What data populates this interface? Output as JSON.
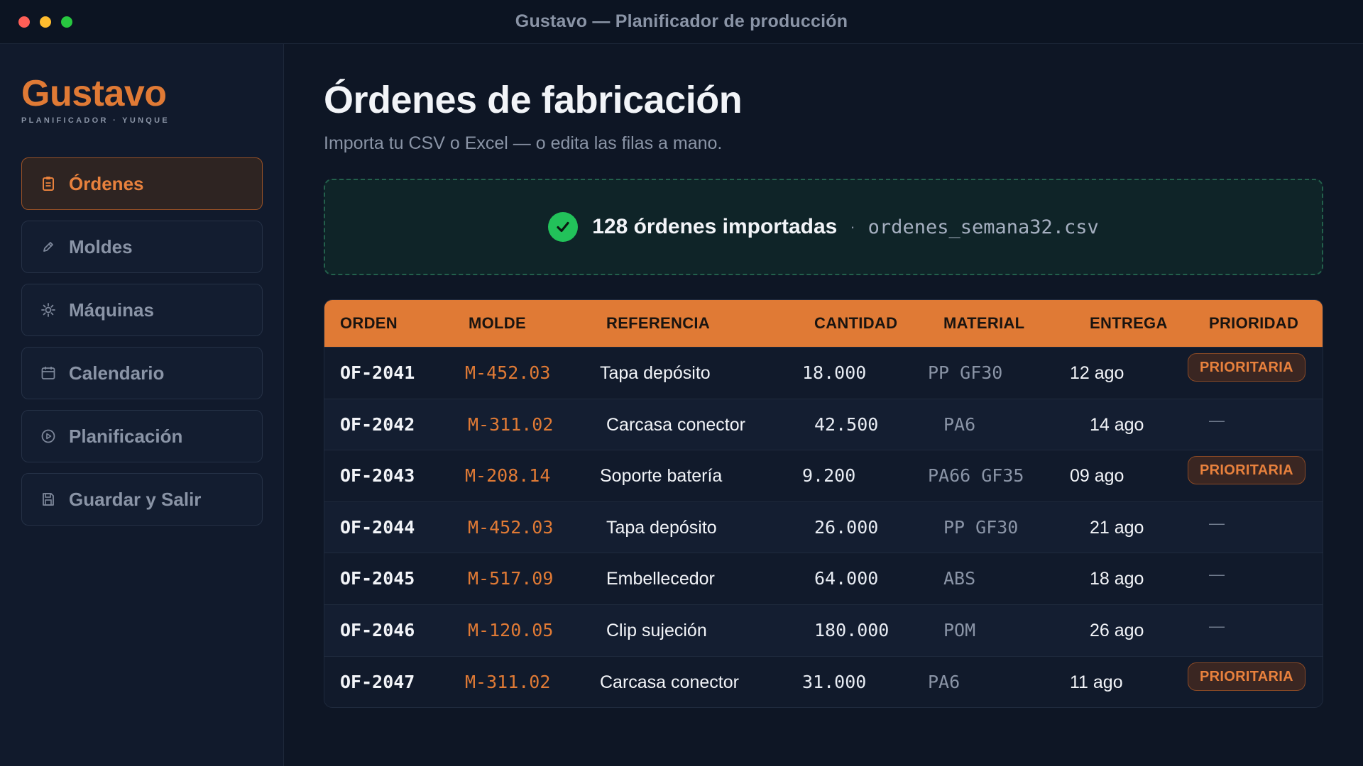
{
  "window": {
    "title": "Gustavo — Planificador de producción"
  },
  "brand": {
    "name": "Gustavo",
    "tagline": "PLANIFICADOR · YUNQUE",
    "accent": "#e07a35"
  },
  "sidebar": {
    "items": [
      {
        "label": "Órdenes",
        "icon": "clipboard-icon",
        "active": true
      },
      {
        "label": "Moldes",
        "icon": "pencil-icon",
        "active": false
      },
      {
        "label": "Máquinas",
        "icon": "gear-icon",
        "active": false
      },
      {
        "label": "Calendario",
        "icon": "calendar-icon",
        "active": false
      },
      {
        "label": "Planificación",
        "icon": "play-circle-icon",
        "active": false
      },
      {
        "label": "Guardar y Salir",
        "icon": "save-icon",
        "active": false
      }
    ]
  },
  "main": {
    "title": "Órdenes de fabricación",
    "subtitle": "Importa tu CSV o Excel — o edita las filas a mano.",
    "import": {
      "count_text": "128 órdenes importadas",
      "separator": "·",
      "filename": "ordenes_semana32.csv",
      "status_color": "#22c25a"
    },
    "table": {
      "headers": [
        "ORDEN",
        "MOLDE",
        "REFERENCIA",
        "CANTIDAD",
        "MATERIAL",
        "ENTREGA",
        "PRIORIDAD"
      ],
      "rows": [
        {
          "orden": "OF-2041",
          "molde": "M-452.03",
          "referencia": "Tapa depósito",
          "cantidad": "18.000",
          "material": "PP GF30",
          "entrega": "12 ago",
          "prioridad": "PRIORITARIA"
        },
        {
          "orden": "OF-2042",
          "molde": "M-311.02",
          "referencia": "Carcasa conector",
          "cantidad": "42.500",
          "material": "PA6",
          "entrega": "14 ago",
          "prioridad": "—"
        },
        {
          "orden": "OF-2043",
          "molde": "M-208.14",
          "referencia": "Soporte batería",
          "cantidad": "9.200",
          "material": "PA66 GF35",
          "entrega": "09 ago",
          "prioridad": "PRIORITARIA"
        },
        {
          "orden": "OF-2044",
          "molde": "M-452.03",
          "referencia": "Tapa depósito",
          "cantidad": "26.000",
          "material": "PP GF30",
          "entrega": "21 ago",
          "prioridad": "—"
        },
        {
          "orden": "OF-2045",
          "molde": "M-517.09",
          "referencia": "Embellecedor",
          "cantidad": "64.000",
          "material": "ABS",
          "entrega": "18 ago",
          "prioridad": "—"
        },
        {
          "orden": "OF-2046",
          "molde": "M-120.05",
          "referencia": "Clip sujeción",
          "cantidad": "180.000",
          "material": "POM",
          "entrega": "26 ago",
          "prioridad": "—"
        },
        {
          "orden": "OF-2047",
          "molde": "M-311.02",
          "referencia": "Carcasa conector",
          "cantidad": "31.000",
          "material": "PA6",
          "entrega": "11 ago",
          "prioridad": "PRIORITARIA"
        }
      ]
    }
  }
}
